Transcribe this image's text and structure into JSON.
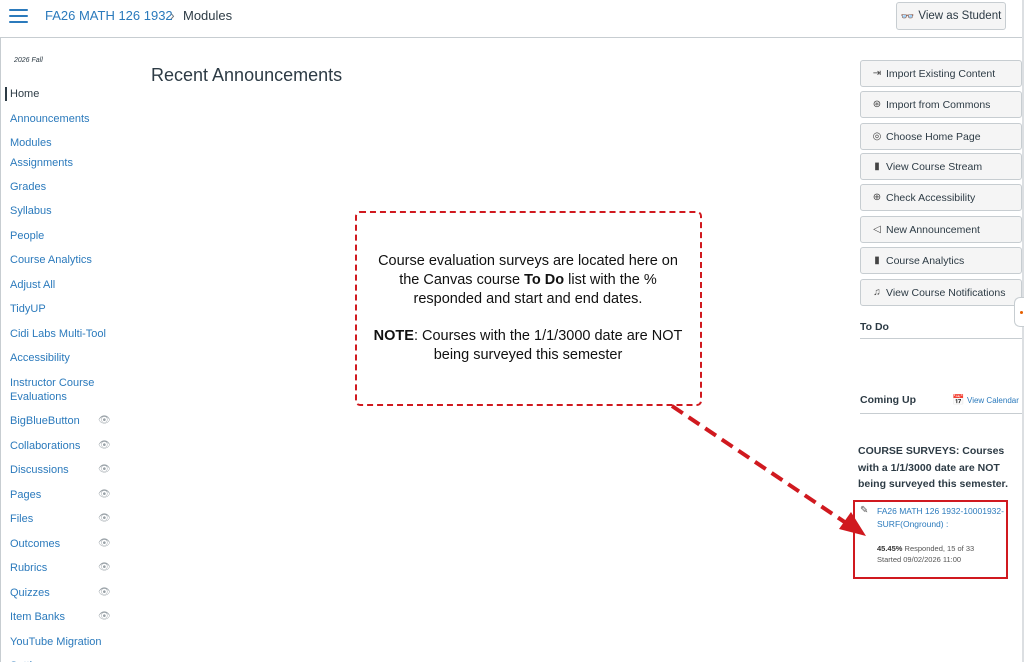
{
  "header": {
    "course_link": "FA26 MATH 126 1932",
    "separator": "›",
    "current_page": "Modules",
    "view_as_student": "View as Student"
  },
  "sidebar": {
    "term": "2026 Fall",
    "items": [
      {
        "label": "Home",
        "active": true,
        "hidden": false
      },
      {
        "label": "Announcements",
        "hidden": false
      },
      {
        "label": "Modules",
        "hidden": false
      },
      {
        "label": "Assignments",
        "hidden": false
      },
      {
        "label": "Grades",
        "hidden": false
      },
      {
        "label": "Syllabus",
        "hidden": false
      },
      {
        "label": "People",
        "hidden": false
      },
      {
        "label": "Course Analytics",
        "hidden": false
      },
      {
        "label": "Adjust All",
        "hidden": false
      },
      {
        "label": "TidyUP",
        "hidden": false
      },
      {
        "label": "Cidi Labs Multi-Tool",
        "hidden": false
      },
      {
        "label": "Accessibility",
        "hidden": false
      },
      {
        "label": "Instructor Course Evaluations",
        "hidden": false
      },
      {
        "label": "BigBlueButton",
        "hidden": true
      },
      {
        "label": "Collaborations",
        "hidden": true
      },
      {
        "label": "Discussions",
        "hidden": true
      },
      {
        "label": "Pages",
        "hidden": true
      },
      {
        "label": "Files",
        "hidden": true
      },
      {
        "label": "Outcomes",
        "hidden": true
      },
      {
        "label": "Rubrics",
        "hidden": true
      },
      {
        "label": "Quizzes",
        "hidden": true
      },
      {
        "label": "Item Banks",
        "hidden": true
      },
      {
        "label": "YouTube Migration",
        "hidden": false
      },
      {
        "label": "Settings",
        "hidden": false
      }
    ]
  },
  "main": {
    "title": "Recent Announcements"
  },
  "callout": {
    "p1_a": "Course evaluation surveys are located here on the Canvas course ",
    "p1_bold": "To Do",
    "p1_b": " list with the % responded and start and end dates.",
    "p2_bold": "NOTE",
    "p2_rest": ": Courses with the 1/1/3000 date are NOT being surveyed this semester",
    "color": "#d0191f"
  },
  "right_sidebar": {
    "buttons": [
      {
        "label": "Import Existing Content",
        "icon": "import-icon"
      },
      {
        "label": "Import from Commons",
        "icon": "commons-icon"
      },
      {
        "label": "Choose Home Page",
        "icon": "target-icon"
      },
      {
        "label": "View Course Stream",
        "icon": "bar-chart-icon"
      },
      {
        "label": "Check Accessibility",
        "icon": "accessibility-icon"
      },
      {
        "label": "New Announcement",
        "icon": "megaphone-icon"
      },
      {
        "label": "Course Analytics",
        "icon": "bar-chart-icon"
      },
      {
        "label": "View Course Notifications",
        "icon": "bell-icon"
      }
    ],
    "todo_heading": "To Do",
    "coming_up_heading": "Coming Up",
    "view_calendar": "View Calendar",
    "survey_note": "COURSE SURVEYS: Courses with a 1/1/3000 date are NOT being surveyed this semester.",
    "survey": {
      "link": "FA26 MATH 126 1932-10001932-SURF(Onground) :",
      "percent": "45.45%",
      "responded": " Responded, 15 of 33",
      "started": "Started 09/02/2026 11:00"
    }
  },
  "colors": {
    "link": "#2b7abc",
    "text": "#2d3b45",
    "highlight": "#d0191f"
  }
}
